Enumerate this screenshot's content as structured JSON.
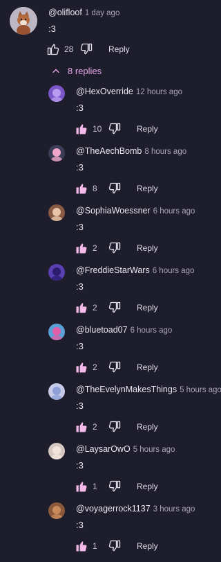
{
  "colors": {
    "background": "#1e1d2b",
    "accent_pink": "#f3b9e9",
    "replies_link": "#e7a7e9",
    "muted_text": "#a9a7b8"
  },
  "top_comment": {
    "author": "@olifloof",
    "time": "1 day ago",
    "text": ":3",
    "likes": "28",
    "reply_label": "Reply",
    "avatar": "fox-avatar-icon"
  },
  "replies_toggle": {
    "label": "8 replies",
    "icon": "chevron-up-icon"
  },
  "replies": [
    {
      "author": "@HexOverride",
      "time": "12 hours ago",
      "text": ":3",
      "likes": "10",
      "reply_label": "Reply",
      "avatar": "purple-cat-avatar-icon"
    },
    {
      "author": "@TheAechBomb",
      "time": "8 hours ago",
      "text": ":3",
      "likes": "8",
      "reply_label": "Reply",
      "avatar": "pink-character-avatar-icon"
    },
    {
      "author": "@SophiaWoessner",
      "time": "6 hours ago",
      "text": ":3",
      "likes": "2",
      "reply_label": "Reply",
      "avatar": "person-avatar-icon"
    },
    {
      "author": "@FreddieStarWars",
      "time": "6 hours ago",
      "text": ":3",
      "likes": "2",
      "reply_label": "Reply",
      "avatar": "planet-avatar-icon"
    },
    {
      "author": "@bluetoad07",
      "time": "6 hours ago",
      "text": ":3",
      "likes": "2",
      "reply_label": "Reply",
      "avatar": "colorful-avatar-icon"
    },
    {
      "author": "@TheEvelynMakesThings",
      "time": "5 hours ago",
      "text": ":3",
      "likes": "2",
      "reply_label": "Reply",
      "avatar": "white-creature-avatar-icon"
    },
    {
      "author": "@LaysarOwO",
      "time": "5 hours ago",
      "text": ":3",
      "likes": "1",
      "reply_label": "Reply",
      "avatar": "anime-avatar-icon"
    },
    {
      "author": "@voyagerrock1137",
      "time": "3 hours ago",
      "text": ":3",
      "likes": "1",
      "reply_label": "Reply",
      "avatar": "rock-avatar-icon"
    }
  ]
}
